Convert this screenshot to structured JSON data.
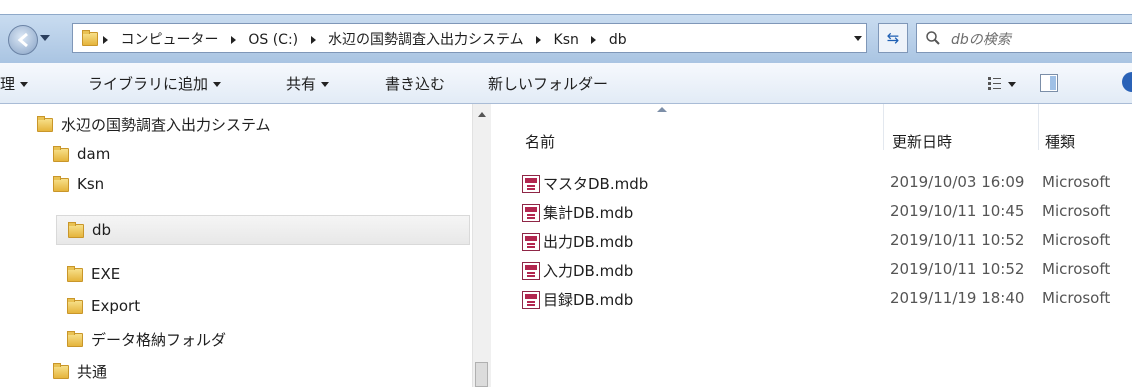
{
  "address_bar": {
    "breadcrumbs": [
      "コンピューター",
      "OS (C:)",
      "水辺の国勢調査入出力システム",
      "Ksn",
      "db"
    ],
    "search_placeholder": "dbの検索"
  },
  "toolbar": {
    "organize_label": "理",
    "add_to_library_label": "ライブラリに追加",
    "share_label": "共有",
    "burn_label": "書き込む",
    "new_folder_label": "新しいフォルダー"
  },
  "nav_tree": [
    {
      "label": "水辺の国勢調査入出力システム",
      "level": 0,
      "selected": false
    },
    {
      "label": "dam",
      "level": 1,
      "selected": false
    },
    {
      "label": "Ksn",
      "level": 1,
      "selected": false
    },
    {
      "label": "db",
      "level": 2,
      "selected": true
    },
    {
      "label": "EXE",
      "level": 2,
      "selected": false
    },
    {
      "label": "Export",
      "level": 2,
      "selected": false
    },
    {
      "label": "データ格納フォルダ",
      "level": 2,
      "selected": false
    },
    {
      "label": "共通",
      "level": 1,
      "selected": false
    }
  ],
  "file_list": {
    "columns": {
      "name": "名前",
      "date": "更新日時",
      "type": "種類"
    },
    "rows": [
      {
        "name": "マスタDB.mdb",
        "date": "2019/10/03 16:09",
        "type": "Microsoft"
      },
      {
        "name": "集計DB.mdb",
        "date": "2019/10/11 10:45",
        "type": "Microsoft"
      },
      {
        "name": "出力DB.mdb",
        "date": "2019/10/11 10:52",
        "type": "Microsoft"
      },
      {
        "name": "入力DB.mdb",
        "date": "2019/10/11 10:52",
        "type": "Microsoft"
      },
      {
        "name": "目録DB.mdb",
        "date": "2019/11/19 18:40",
        "type": "Microsoft"
      }
    ]
  },
  "icons": {
    "folder": "folder-icon",
    "access_db": "access-db-icon",
    "back": "back-arrow-icon",
    "refresh": "refresh-icon",
    "search": "search-icon"
  },
  "colors": {
    "address_gradient_top": "#c9dcf0",
    "toolbar_bg": "#e2ebf6",
    "selection_bg": "#e8e8e8",
    "access_icon": "#b2264f"
  }
}
